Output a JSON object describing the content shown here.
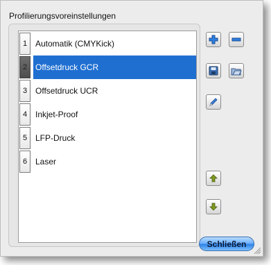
{
  "groupbox": {
    "title": "Profilierungsvoreinstellungen"
  },
  "list": {
    "items": [
      {
        "number": "1",
        "label": "Automatik (CMYKick)",
        "selected": false
      },
      {
        "number": "2",
        "label": "Offsetdruck GCR",
        "selected": true
      },
      {
        "number": "3",
        "label": "Offsetdruck UCR",
        "selected": false
      },
      {
        "number": "4",
        "label": "Inkjet-Proof",
        "selected": false
      },
      {
        "number": "5",
        "label": "LFP-Druck",
        "selected": false
      },
      {
        "number": "6",
        "label": "Laser",
        "selected": false
      }
    ]
  },
  "toolbar": {
    "icons": [
      "plus-icon",
      "minus-icon",
      "save-icon",
      "open-icon",
      "pencil-icon",
      "arrow-up-icon",
      "arrow-down-icon"
    ]
  },
  "footer": {
    "close_label": "Schließen"
  },
  "colors": {
    "selection": "#1f6fd1",
    "button_blue": "#2f83e6",
    "arrow_green": "#7e9a1e"
  }
}
